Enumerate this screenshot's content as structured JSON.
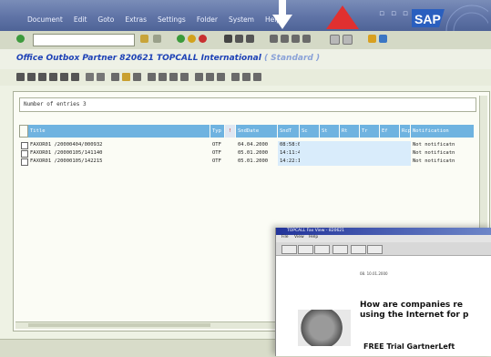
{
  "menubar": {
    "items": [
      "Document",
      "Edit",
      "Goto",
      "Extras",
      "Settings",
      "Folder",
      "System",
      "Help"
    ],
    "brand": "SAP",
    "colors": {
      "bar": "#5f73a6",
      "red_arrow": "#e03030",
      "white_arrow": "#ffffff"
    }
  },
  "toolbar": {
    "command_field_value": "",
    "icons": [
      "enter-check-icon",
      "save-icon",
      "back-icon",
      "exit-icon",
      "cancel-icon",
      "print-icon",
      "find-icon",
      "find-next-icon",
      "first-page-icon",
      "previous-page-icon",
      "next-page-icon",
      "last-page-icon",
      "new-session-icon",
      "shortcut-icon",
      "help-icon",
      "layout-icon"
    ]
  },
  "title": {
    "text": "Office  Outbox  Partner  820621  TOPCALL  International",
    "suffix": "( Standard )",
    "color": "#1e42b6"
  },
  "app_toolbar": {
    "icons": [
      "details-icon",
      "select-all-icon",
      "deselect-icon",
      "sort-asc-icon",
      "sort-desc-icon",
      "filter-icon",
      "sum-icon",
      "print-icon",
      "export-icon",
      "mail-icon",
      "layout-icon",
      "refresh-icon"
    ]
  },
  "list": {
    "entries_label": "Number of entries 3",
    "columns": [
      "Title",
      "Typ",
      "!",
      "SndDate",
      "SndT",
      "Sc",
      "St",
      "Rt",
      "Tr",
      "Ef",
      "Rcp",
      "Notification"
    ],
    "rows": [
      {
        "title": "FAXOR01 /20000404/000932",
        "typ": "OTF",
        "date": "04.04.2000",
        "time": "08:58:00",
        "notification": "Not notificatn"
      },
      {
        "title": "FAXOR01 /20000105/141140",
        "typ": "OTF",
        "date": "05.01.2000",
        "time": "14:11:40",
        "notification": "Not notificatn"
      },
      {
        "title": "FAXOR01 /20000105/142215",
        "typ": "OTF",
        "date": "05.01.2000",
        "time": "14:22:15",
        "notification": "Not notificatn"
      }
    ],
    "header_color": "#6fb3e0"
  },
  "fax_window": {
    "title": "TOPCALL Fax View - 820621",
    "menu": [
      "File",
      "View",
      "Help"
    ],
    "page_line": "08. 10.01.2000",
    "headline_lines": [
      "How are companies re",
      "using the Internet for p"
    ],
    "footer": "FREE Trial GartnerLeft"
  }
}
